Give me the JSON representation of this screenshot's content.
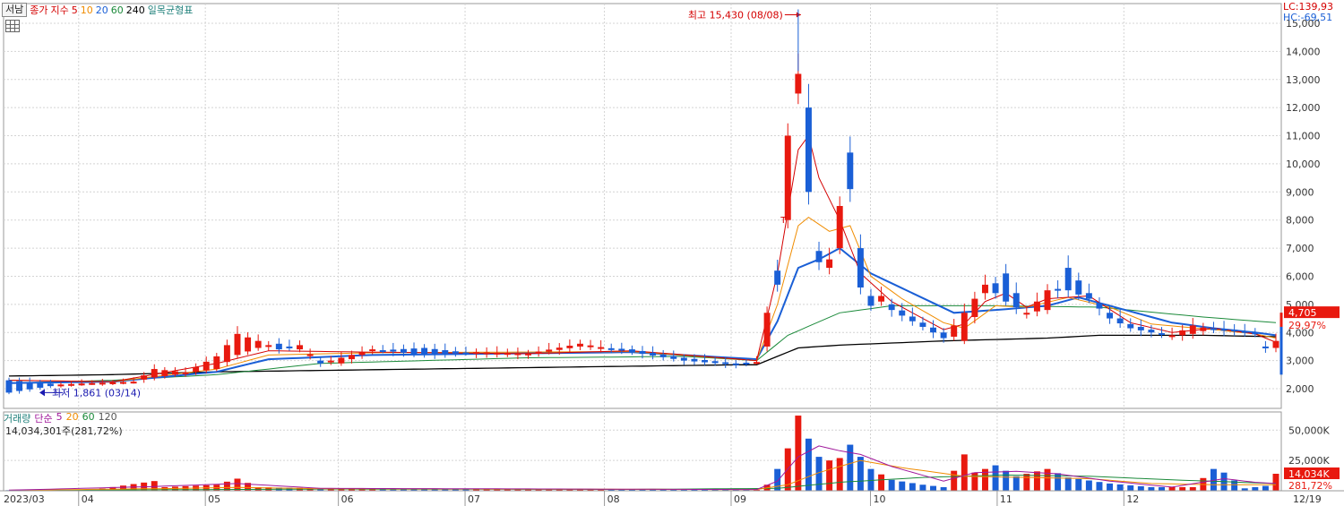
{
  "header": {
    "stock_name": "서남",
    "legend_items": [
      {
        "label": "종가",
        "color": "#d40000"
      },
      {
        "label": "지수",
        "color": "#d40000"
      },
      {
        "label": "5",
        "color": "#d40000"
      },
      {
        "label": "10",
        "color": "#f08c00"
      },
      {
        "label": "20",
        "color": "#1a5fd6"
      },
      {
        "label": "60",
        "color": "#1b8a3a"
      },
      {
        "label": "240",
        "color": "#000000"
      },
      {
        "label": "일목균형표",
        "color": "#1e7f7a"
      }
    ],
    "lc": "LC:139,93",
    "hc": "HC:-69,51"
  },
  "volume_header": {
    "legend_items": [
      {
        "label": "거래량",
        "color": "#1e7f7a"
      },
      {
        "label": "단순",
        "color": "#a0189b"
      },
      {
        "label": "5",
        "color": "#a0189b"
      },
      {
        "label": "20",
        "color": "#f08c00"
      },
      {
        "label": "60",
        "color": "#1b8a3a"
      },
      {
        "label": "120",
        "color": "#555555"
      }
    ],
    "current_volume": "14,034,301주(281,72%)"
  },
  "chart_data": [
    {
      "type": "candlestick",
      "title": "",
      "x_axis_labels": [
        "2023/03",
        "04",
        "05",
        "06",
        "07",
        "08",
        "09",
        "10",
        "11",
        "12",
        "12/19"
      ],
      "y_ticks": [
        2000,
        3000,
        4000,
        5000,
        6000,
        7000,
        8000,
        9000,
        10000,
        11000,
        12000,
        13000,
        14000,
        15000
      ],
      "y_tick_labels": [
        "2,000",
        "3,000",
        "4,000",
        "5,000",
        "6,000",
        "7,000",
        "8,000",
        "9,000",
        "10,000",
        "11,000",
        "12,000",
        "13,000",
        "14,000",
        "15,000"
      ],
      "ylim": [
        1300,
        15700
      ],
      "grid": true,
      "annotations": {
        "high": {
          "label": "최고 15,430 (08/08)",
          "value": 15430
        },
        "low": {
          "label": "최저 1,861 (03/14)",
          "value": 1861
        },
        "marker": "T"
      },
      "current_price": {
        "label": "4,705",
        "value": 4705
      },
      "change_pct": "29,97%",
      "up_color": "#e8190f",
      "down_color": "#1a5fd6",
      "ma_colors": {
        "ma5": "#d40000",
        "ma10": "#f08c00",
        "ma20": "#1a5fd6",
        "ma60": "#1b8a3a",
        "ma240": "#000000"
      },
      "ohlc_anchors": [
        [
          0,
          2300,
          1861
        ],
        [
          5,
          2150,
          2150
        ],
        [
          8,
          2200,
          2200
        ],
        [
          12,
          2250,
          2250
        ],
        [
          14,
          2400,
          2700
        ],
        [
          17,
          2550,
          2580
        ],
        [
          20,
          2700,
          3150
        ],
        [
          22,
          3200,
          3950
        ],
        [
          24,
          3450,
          3700
        ],
        [
          26,
          3600,
          3400
        ],
        [
          28,
          3400,
          3550
        ],
        [
          30,
          3000,
          2900
        ],
        [
          32,
          2900,
          3100
        ],
        [
          35,
          3350,
          3400
        ],
        [
          40,
          3450,
          3200
        ],
        [
          45,
          3250,
          3300
        ],
        [
          50,
          3200,
          3250
        ],
        [
          55,
          3500,
          3600
        ],
        [
          60,
          3400,
          3300
        ],
        [
          65,
          3100,
          3000
        ],
        [
          70,
          2900,
          2850
        ],
        [
          72,
          2950,
          2950
        ],
        [
          73,
          3500,
          4700
        ],
        [
          74,
          6200,
          5700
        ],
        [
          75,
          8000,
          11000
        ],
        [
          76,
          12500,
          13200
        ],
        [
          77,
          12000,
          9000
        ],
        [
          78,
          6900,
          6500
        ],
        [
          79,
          6300,
          6600
        ],
        [
          80,
          7000,
          8500
        ],
        [
          81,
          10400,
          9100
        ],
        [
          82,
          7000,
          5600
        ],
        [
          83,
          5300,
          4950
        ],
        [
          84,
          5100,
          5300
        ],
        [
          85,
          5000,
          4800
        ],
        [
          88,
          4350,
          4200
        ],
        [
          90,
          4000,
          3800
        ],
        [
          92,
          3700,
          4700
        ],
        [
          94,
          5400,
          5700
        ],
        [
          96,
          6100,
          5100
        ],
        [
          98,
          4700,
          4700
        ],
        [
          100,
          4800,
          5500
        ],
        [
          102,
          6300,
          5500
        ],
        [
          104,
          5400,
          5200
        ],
        [
          106,
          4700,
          4500
        ],
        [
          108,
          4300,
          4150
        ],
        [
          110,
          4100,
          4000
        ],
        [
          112,
          3850,
          3900
        ],
        [
          114,
          3950,
          4250
        ],
        [
          116,
          4150,
          4100
        ],
        [
          118,
          4100,
          4050
        ],
        [
          120,
          4000,
          3950
        ],
        [
          121,
          3500,
          3450
        ],
        [
          122,
          3450,
          3700
        ]
      ],
      "ma_anchors": {
        "ma5": [
          [
            0,
            2300
          ],
          [
            10,
            2250
          ],
          [
            20,
            2900
          ],
          [
            25,
            3350
          ],
          [
            35,
            3300
          ],
          [
            50,
            3250
          ],
          [
            60,
            3350
          ],
          [
            72,
            3000
          ],
          [
            74,
            6100
          ],
          [
            76,
            10500
          ],
          [
            77,
            11000
          ],
          [
            78,
            9500
          ],
          [
            80,
            8000
          ],
          [
            82,
            6100
          ],
          [
            85,
            5100
          ],
          [
            90,
            4100
          ],
          [
            92,
            4300
          ],
          [
            94,
            5100
          ],
          [
            96,
            5400
          ],
          [
            98,
            4900
          ],
          [
            100,
            5200
          ],
          [
            104,
            5300
          ],
          [
            108,
            4350
          ],
          [
            112,
            4000
          ],
          [
            116,
            4150
          ],
          [
            120,
            3950
          ],
          [
            122,
            3650
          ]
        ],
        "ma10": [
          [
            0,
            2300
          ],
          [
            10,
            2250
          ],
          [
            20,
            2700
          ],
          [
            25,
            3200
          ],
          [
            35,
            3280
          ],
          [
            60,
            3320
          ],
          [
            72,
            3000
          ],
          [
            74,
            5000
          ],
          [
            76,
            7800
          ],
          [
            77,
            8100
          ],
          [
            79,
            7600
          ],
          [
            81,
            7800
          ],
          [
            83,
            6000
          ],
          [
            86,
            5200
          ],
          [
            90,
            4350
          ],
          [
            92,
            4150
          ],
          [
            95,
            4950
          ],
          [
            98,
            4900
          ],
          [
            102,
            5250
          ],
          [
            106,
            4900
          ],
          [
            110,
            4300
          ],
          [
            116,
            4100
          ],
          [
            120,
            3950
          ],
          [
            122,
            3800
          ]
        ],
        "ma20": [
          [
            0,
            2200
          ],
          [
            10,
            2250
          ],
          [
            20,
            2600
          ],
          [
            25,
            3050
          ],
          [
            35,
            3200
          ],
          [
            60,
            3300
          ],
          [
            72,
            3050
          ],
          [
            74,
            4400
          ],
          [
            76,
            6300
          ],
          [
            78,
            6600
          ],
          [
            80,
            7000
          ],
          [
            83,
            6100
          ],
          [
            87,
            5400
          ],
          [
            91,
            4700
          ],
          [
            95,
            4800
          ],
          [
            100,
            4950
          ],
          [
            103,
            5250
          ],
          [
            107,
            4850
          ],
          [
            112,
            4350
          ],
          [
            116,
            4150
          ],
          [
            120,
            4000
          ],
          [
            122,
            3900
          ]
        ],
        "ma60": [
          [
            0,
            2200
          ],
          [
            10,
            2300
          ],
          [
            20,
            2500
          ],
          [
            30,
            2900
          ],
          [
            50,
            3100
          ],
          [
            65,
            3150
          ],
          [
            72,
            3000
          ],
          [
            75,
            3900
          ],
          [
            80,
            4700
          ],
          [
            85,
            4950
          ],
          [
            95,
            4950
          ],
          [
            105,
            4900
          ],
          [
            115,
            4550
          ],
          [
            122,
            4350
          ]
        ],
        "ma240": [
          [
            0,
            2450
          ],
          [
            10,
            2500
          ],
          [
            20,
            2600
          ],
          [
            40,
            2700
          ],
          [
            60,
            2800
          ],
          [
            70,
            2850
          ],
          [
            72,
            2850
          ],
          [
            76,
            3450
          ],
          [
            80,
            3550
          ],
          [
            90,
            3700
          ],
          [
            100,
            3800
          ],
          [
            105,
            3900
          ],
          [
            115,
            3900
          ],
          [
            122,
            3850
          ]
        ]
      }
    },
    {
      "type": "bar",
      "title": "거래량",
      "y_ticks": [
        25000,
        50000
      ],
      "y_tick_labels": [
        "25,000K",
        "50,000K"
      ],
      "ylim": [
        0,
        65000
      ],
      "current_volume": {
        "label": "14,034K",
        "value": 14034
      },
      "current_ratio": "281,72%",
      "volume_anchors": [
        [
          0,
          500
        ],
        [
          8,
          600
        ],
        [
          14,
          8000
        ],
        [
          15,
          3000
        ],
        [
          20,
          5000
        ],
        [
          22,
          10000
        ],
        [
          24,
          3000
        ],
        [
          30,
          2000
        ],
        [
          40,
          1200
        ],
        [
          55,
          1500
        ],
        [
          65,
          1000
        ],
        [
          72,
          800
        ],
        [
          73,
          5000
        ],
        [
          74,
          18000
        ],
        [
          75,
          35000
        ],
        [
          76,
          62000
        ],
        [
          77,
          43000
        ],
        [
          78,
          28000
        ],
        [
          79,
          25000
        ],
        [
          80,
          27000
        ],
        [
          81,
          38000
        ],
        [
          82,
          28000
        ],
        [
          83,
          18000
        ],
        [
          85,
          9000
        ],
        [
          88,
          5000
        ],
        [
          90,
          3000
        ],
        [
          92,
          30000
        ],
        [
          93,
          15000
        ],
        [
          95,
          21000
        ],
        [
          97,
          12000
        ],
        [
          100,
          18000
        ],
        [
          102,
          11000
        ],
        [
          106,
          6000
        ],
        [
          110,
          3000
        ],
        [
          114,
          3000
        ],
        [
          116,
          18000
        ],
        [
          117,
          15000
        ],
        [
          119,
          2000
        ],
        [
          121,
          4000
        ],
        [
          122,
          14034
        ]
      ],
      "ma_anchors": {
        "ma5": [
          [
            0,
            500
          ],
          [
            14,
            3500
          ],
          [
            22,
            6000
          ],
          [
            30,
            2000
          ],
          [
            72,
            1000
          ],
          [
            74,
            8000
          ],
          [
            76,
            28000
          ],
          [
            78,
            37000
          ],
          [
            80,
            33000
          ],
          [
            82,
            30000
          ],
          [
            85,
            20000
          ],
          [
            90,
            8000
          ],
          [
            93,
            15000
          ],
          [
            97,
            16000
          ],
          [
            101,
            14000
          ],
          [
            106,
            8000
          ],
          [
            112,
            3000
          ],
          [
            117,
            10000
          ],
          [
            120,
            7000
          ],
          [
            122,
            6000
          ]
        ],
        "ma20": [
          [
            0,
            400
          ],
          [
            15,
            1800
          ],
          [
            22,
            2800
          ],
          [
            30,
            1700
          ],
          [
            72,
            1000
          ],
          [
            75,
            5000
          ],
          [
            78,
            15000
          ],
          [
            82,
            25000
          ],
          [
            86,
            19000
          ],
          [
            92,
            12000
          ],
          [
            98,
            11000
          ],
          [
            104,
            10000
          ],
          [
            110,
            6000
          ],
          [
            116,
            5000
          ],
          [
            122,
            5000
          ]
        ],
        "ma60": [
          [
            0,
            300
          ],
          [
            30,
            1400
          ],
          [
            60,
            1100
          ],
          [
            74,
            2000
          ],
          [
            80,
            7000
          ],
          [
            88,
            11000
          ],
          [
            96,
            13000
          ],
          [
            104,
            12000
          ],
          [
            112,
            9000
          ],
          [
            122,
            6000
          ]
        ]
      }
    }
  ]
}
